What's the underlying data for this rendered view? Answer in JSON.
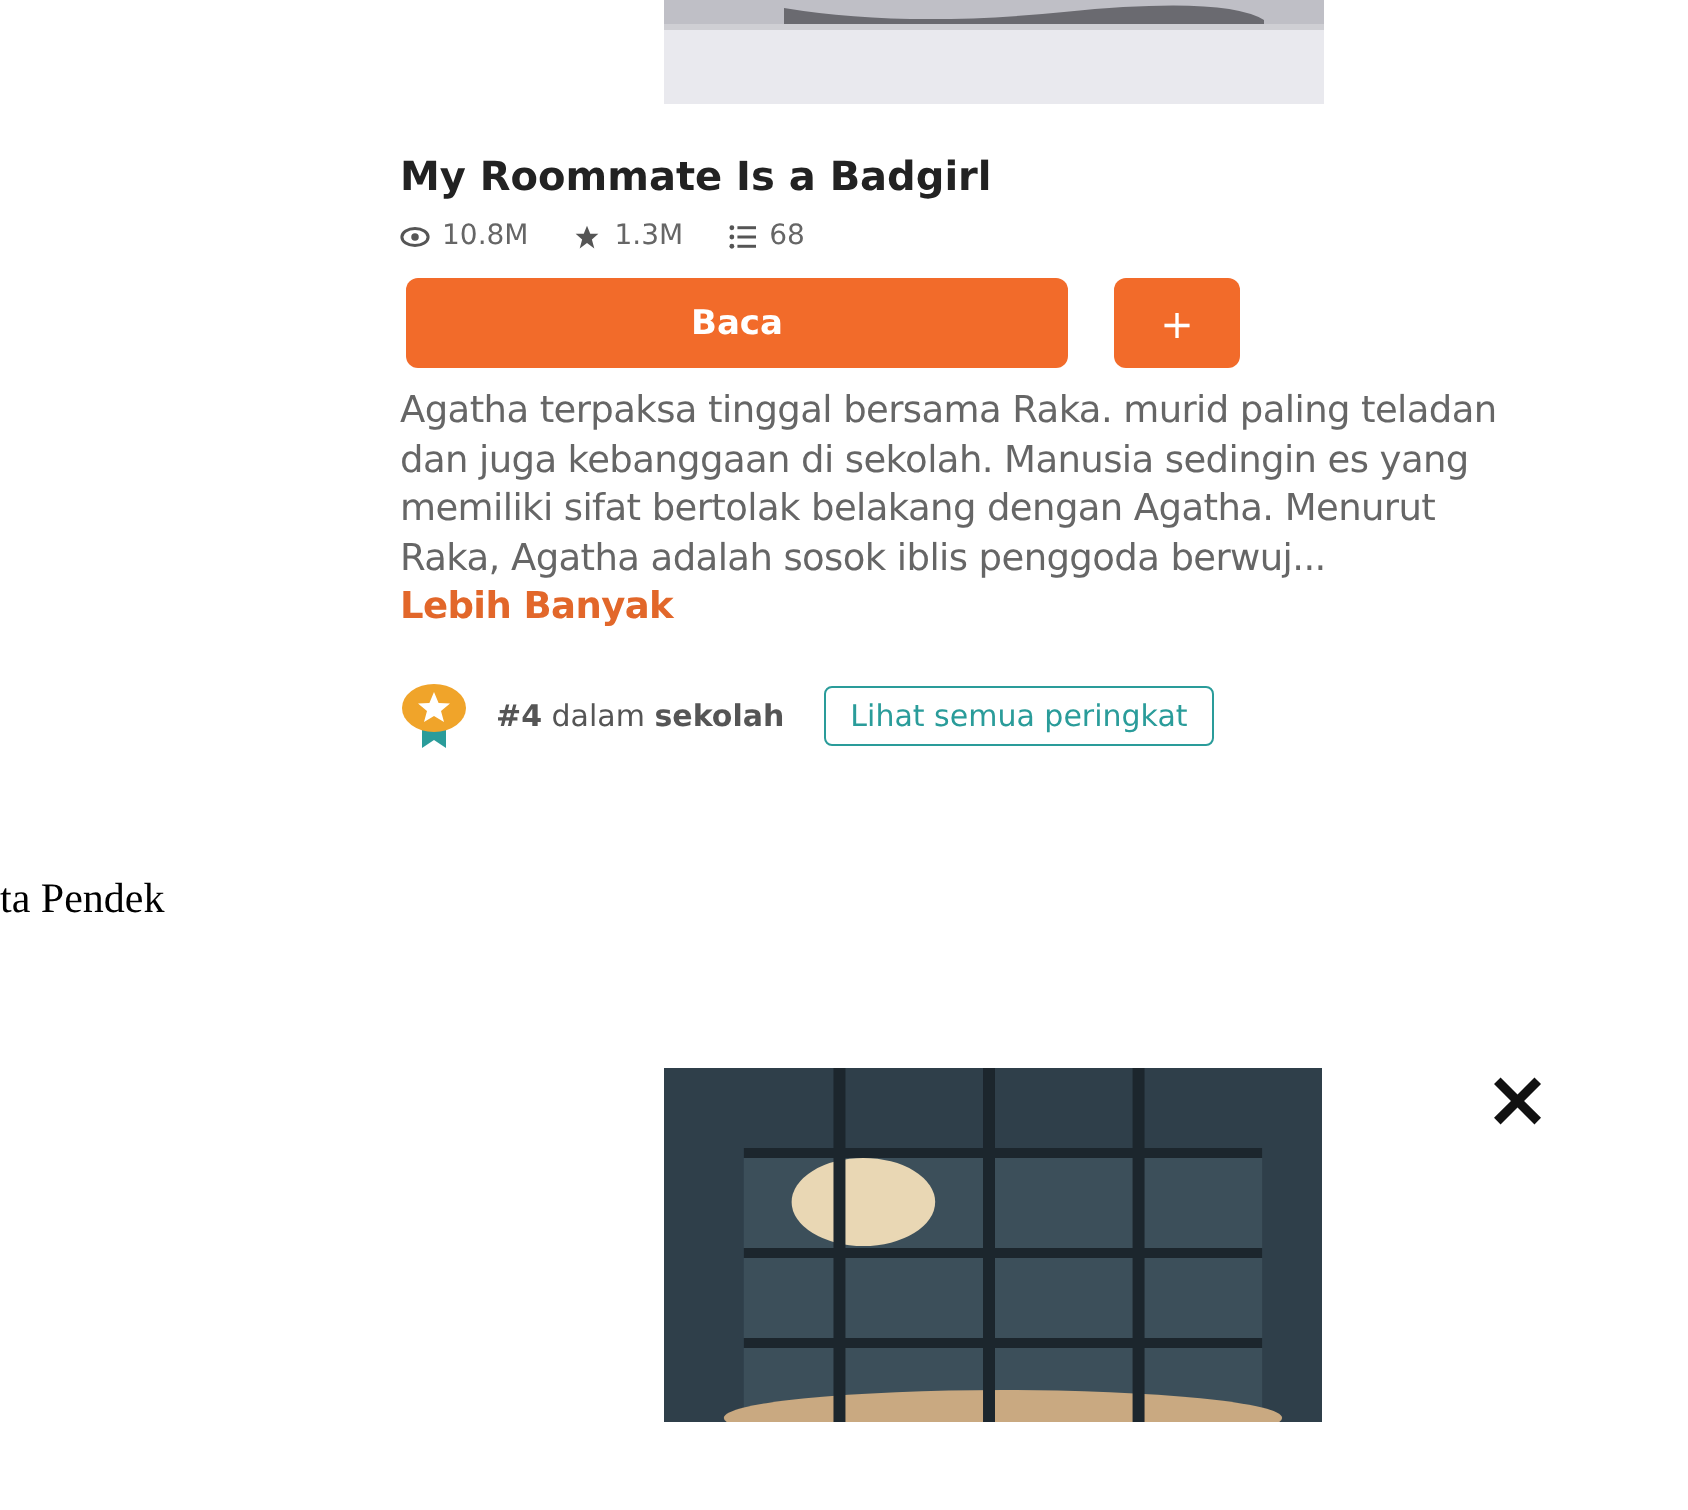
{
  "story": {
    "title": "My Roommate Is a Badgirl",
    "stats": [
      {
        "kind": "views",
        "value": "10.8M"
      },
      {
        "kind": "votes",
        "value": "1.3M"
      },
      {
        "kind": "parts",
        "value": "68"
      }
    ],
    "read_button": "Baca",
    "add_button": "+",
    "description": "Agatha terpaksa tinggal bersama Raka. murid paling teladan dan juga kebanggaan di sekolah. Manusia sedingin es yang memiliki sifat bertolak belakang dengan Agatha. Menurut Raka, Agatha adalah sosok iblis penggoda berwuj...",
    "more_link": "Lebih Banyak",
    "rank": "**#4** dalam **sekolah**",
    "rank_button": "Lihat semua peringkat"
  },
  "document_text": "ta Pendek",
  "next_story": {
    "close": "×"
  }
}
